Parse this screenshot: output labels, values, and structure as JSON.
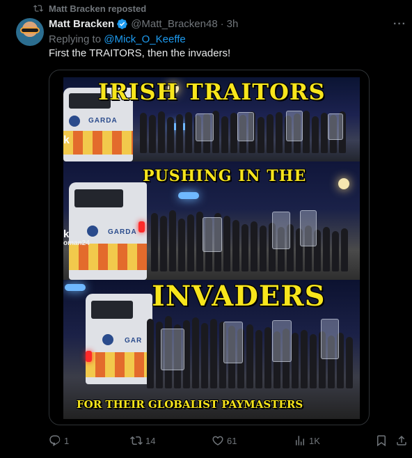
{
  "repost": {
    "text": "Matt Bracken reposted"
  },
  "author": {
    "name": "Matt Bracken",
    "handle": "@Matt_Bracken48",
    "separator": "·",
    "time": "3h"
  },
  "reply": {
    "prefix": "Replying to",
    "mention": "@Mick_O_Keeffe"
  },
  "tweet": {
    "text": "First the TRAITORS, then the invaders!"
  },
  "media": {
    "captions": [
      "IRISH TRAITORS",
      "PUSHING IN THE",
      "INVADERS",
      "FOR THEIR GLOBALIST PAYMASTERS"
    ],
    "van_labels": [
      "GARDA",
      "GARDA",
      "GAR"
    ],
    "overlay_texts": [
      "oman24",
      "k"
    ]
  },
  "actions": {
    "replies": "1",
    "reposts": "14",
    "likes": "61",
    "views": "1K"
  },
  "colors": {
    "accent": "#1d9bf0",
    "muted": "#71767b",
    "caption": "#f7e51c",
    "background": "#000000"
  },
  "icons": [
    "repost-icon",
    "verified-icon",
    "more-icon",
    "reply-icon",
    "like-icon",
    "views-icon",
    "bookmark-icon",
    "share-icon"
  ]
}
